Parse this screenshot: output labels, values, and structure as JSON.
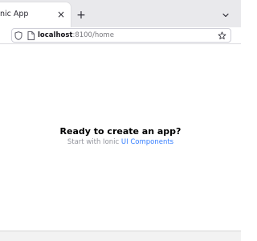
{
  "tabs": [
    {
      "title": "nic App"
    }
  ],
  "address_bar": {
    "host": "localhost",
    "rest": ":8100/home"
  },
  "page": {
    "headline": "Ready to create an app?",
    "sub_prefix": "Start with Ionic",
    "sub_link": "UI Components"
  },
  "colors": {
    "link": "#3880ff",
    "muted": "#92949c"
  },
  "icons": {
    "close": "×",
    "new_tab": "+",
    "list_tabs": "chevron-down"
  }
}
